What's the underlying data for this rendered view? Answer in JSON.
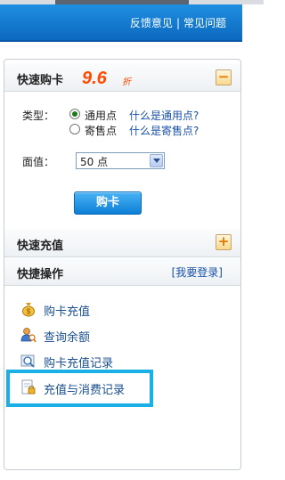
{
  "topbar": {
    "feedback": "反馈意见",
    "separator": "|",
    "faq": "常见问题"
  },
  "quick_buy": {
    "title": "快速购卡",
    "discount": "9.6",
    "discount_unit": "折",
    "collapse_symbol": "−",
    "type_label": "类型：",
    "options": [
      {
        "label": "通用点",
        "help": "什么是通用点?",
        "selected": true
      },
      {
        "label": "寄售点",
        "help": "什么是寄售点?",
        "selected": false
      }
    ],
    "value_label": "面值：",
    "value_selected": "50 点",
    "buy_button": "购卡"
  },
  "quick_recharge": {
    "title": "快速充值",
    "expand_symbol": "+"
  },
  "quick_ops": {
    "title": "快捷操作",
    "login_link": "[我要登录]",
    "items": [
      {
        "label": "购卡充值",
        "icon": "money-bag-icon"
      },
      {
        "label": "查询余额",
        "icon": "user-search-icon"
      },
      {
        "label": "购卡充值记录",
        "icon": "magnifier-record-icon"
      },
      {
        "label": "充值与消费记录",
        "icon": "document-lock-icon"
      }
    ]
  },
  "colors": {
    "accent_blue": "#0c79d0",
    "discount_orange": "#ff4a00",
    "highlight": "#1ab0e6",
    "link": "#1a52a8"
  }
}
